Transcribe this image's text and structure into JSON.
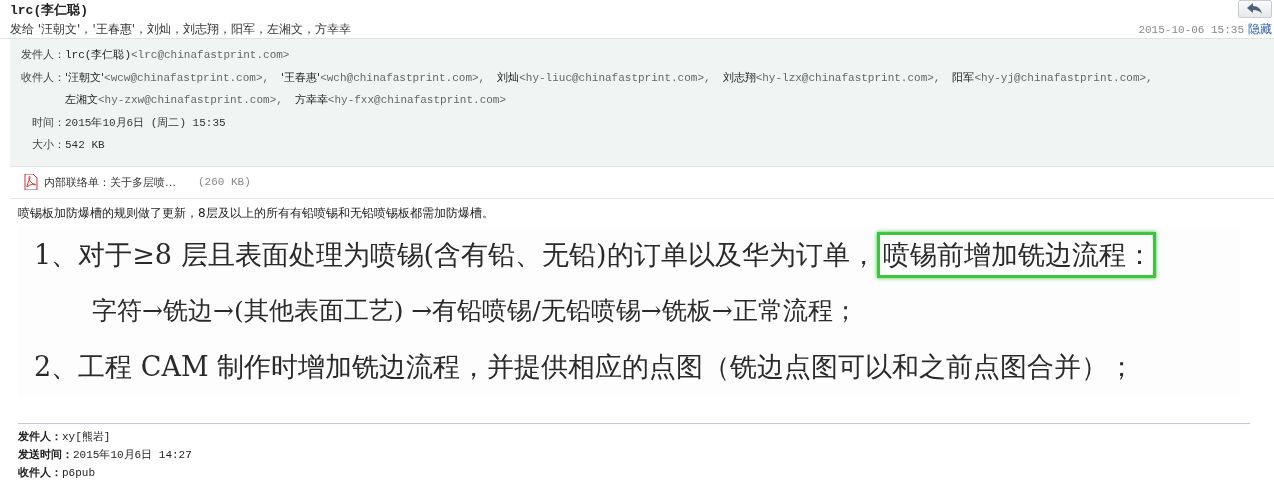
{
  "message": {
    "sender_title": "lrc(李仁聪)",
    "to_summary": "发给 '汪朝文'，'王春惠'，刘灿，刘志翔，阳军，左湘文，方幸幸",
    "date": "2015-10-06 15:35",
    "hide_link": "隐藏"
  },
  "details": {
    "from": {
      "label": "发件人：",
      "name": "lrc(李仁聪)",
      "email": "<lrc@chinafastprint.com>"
    },
    "to": {
      "label": "收件人：",
      "lines": [
        [
          {
            "name": "'汪朝文'",
            "email": "<wcw@chinafastprint.com>,"
          },
          {
            "name": "'王春惠'",
            "email": "<wch@chinafastprint.com>,"
          },
          {
            "name": "刘灿",
            "email": "<hy-liuc@chinafastprint.com>,"
          },
          {
            "name": "刘志翔",
            "email": "<hy-lzx@chinafastprint.com>,"
          },
          {
            "name": "阳军",
            "email": "<hy-yj@chinafastprint.com>,"
          }
        ],
        [
          {
            "name": "左湘文",
            "email": "<hy-zxw@chinafastprint.com>,"
          },
          {
            "name": "方幸幸",
            "email": "<hy-fxx@chinafastprint.com>"
          }
        ]
      ]
    },
    "time": {
      "label": "时间：",
      "value": "2015年10月6日 (周二) 15:35"
    },
    "size": {
      "label": "大小：",
      "value": "542 KB"
    }
  },
  "attachment": {
    "name": "内部联络单：关于多层喷…",
    "size": "(260 KB)"
  },
  "body": {
    "text": "喷锡板加防爆槽的规则做了更新，8层及以上的所有有铅喷锡和无铅喷锡板都需加防爆槽。",
    "image_lines": [
      {
        "kind": "numbered",
        "text": "1、对于≥8 层且表面处理为喷锡(含有铅、无铅)的订单以及华为订单，",
        "highlight": "喷锡前增加铣边流程："
      },
      {
        "kind": "indented",
        "text": "字符→铣边→(其他表面工艺) →有铅喷锡/无铅喷锡→铣板→正常流程；"
      },
      {
        "kind": "numbered",
        "text": "2、工程 CAM 制作时增加铣边流程，并提供相应的点图（铣边点图可以和之前点图合并）；"
      }
    ]
  },
  "forwarded": [
    {
      "label": "发件人：",
      "value": "xy[熊岩]"
    },
    {
      "label": "发送时间：",
      "value": "2015年10月6日 14:27"
    },
    {
      "label": "收件人：",
      "value": "p6pub"
    }
  ]
}
